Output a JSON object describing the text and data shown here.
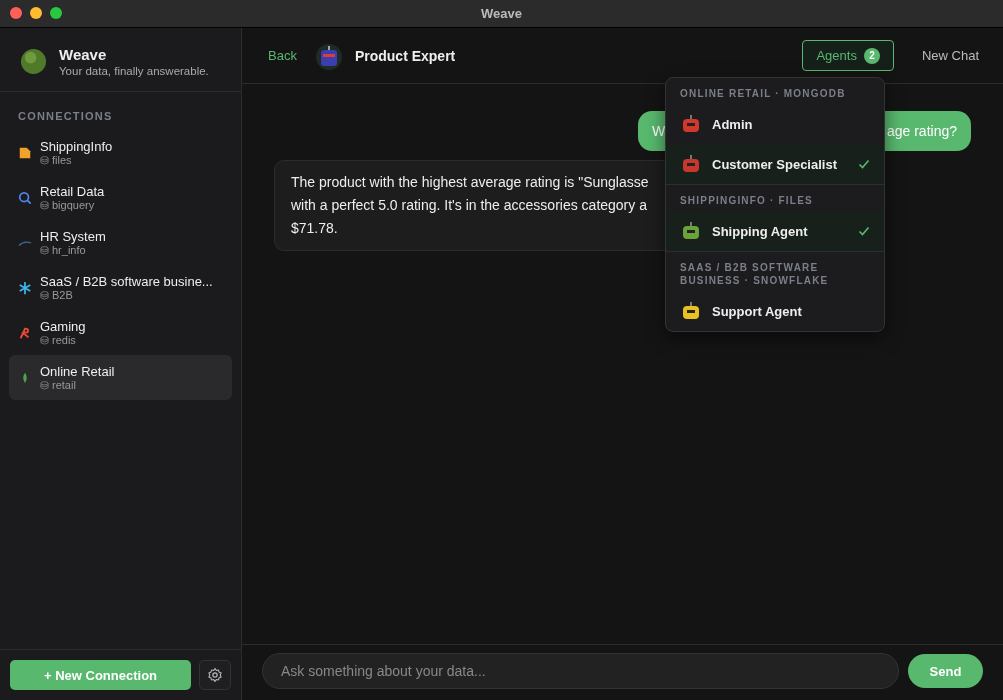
{
  "window": {
    "title": "Weave"
  },
  "brand": {
    "name": "Weave",
    "tagline": "Your data, finally answerable."
  },
  "sidebar": {
    "heading": "CONNECTIONS",
    "items": [
      {
        "name": "ShippingInfo",
        "source": "files",
        "kind": "file",
        "selected": false
      },
      {
        "name": "Retail Data",
        "source": "bigquery",
        "kind": "bigquery",
        "selected": false
      },
      {
        "name": "HR System",
        "source": "hr_info",
        "kind": "mysql",
        "selected": false
      },
      {
        "name": "SaaS / B2B software busine...",
        "source": "B2B",
        "kind": "snowflake",
        "selected": false
      },
      {
        "name": "Gaming",
        "source": "redis",
        "kind": "redis",
        "selected": false
      },
      {
        "name": "Online Retail",
        "source": "retail",
        "kind": "mongodb",
        "selected": true
      }
    ],
    "new_button": "+ New Connection"
  },
  "header": {
    "back": "Back",
    "agent_name": "Product Expert",
    "agents_button": "Agents",
    "agents_count": "2",
    "new_chat": "New Chat"
  },
  "messages": [
    {
      "kind": "user",
      "parts": [
        "W",
        "age rating?"
      ]
    },
    {
      "kind": "bot",
      "lines": [
        "The product with the highest average rating is \"Sunglasse",
        "with a perfect 5.0 rating. It's in the accessories category a",
        "$71.78."
      ]
    }
  ],
  "dropdown": {
    "groups": [
      {
        "heading": "ONLINE RETAIL · MONGODB",
        "agents": [
          {
            "name": "Admin",
            "color": "#d0392b",
            "checked": false
          },
          {
            "name": "Customer Specialist",
            "color": "#c9372c",
            "checked": true
          }
        ]
      },
      {
        "heading": "SHIPPINGINFO · FILES",
        "agents": [
          {
            "name": "Shipping Agent",
            "color": "#6aa33a",
            "checked": true
          }
        ]
      },
      {
        "heading": "SAAS / B2B SOFTWARE BUSINESS · SNOWFLAKE",
        "agents": [
          {
            "name": "Support Agent",
            "color": "#e8c021",
            "checked": false
          }
        ]
      }
    ]
  },
  "composer": {
    "placeholder": "Ask something about your data...",
    "send": "Send"
  }
}
